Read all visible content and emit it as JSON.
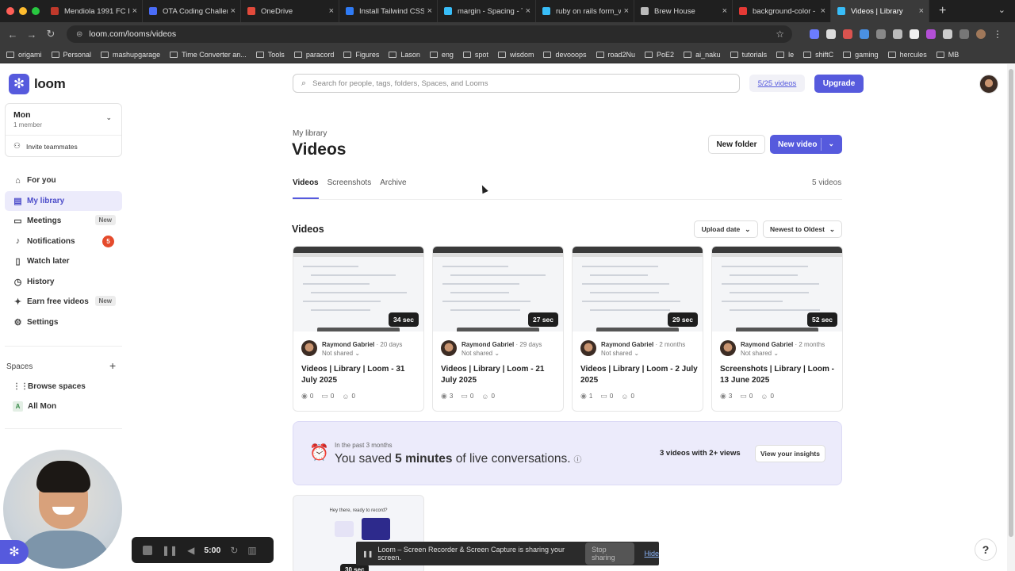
{
  "browser": {
    "tabs": [
      {
        "title": "Mendiola 1991 FC B",
        "color": "#c0392b"
      },
      {
        "title": "OTA Coding Challen",
        "color": "#4a6cf7"
      },
      {
        "title": "OneDrive",
        "color": "#e24a3b"
      },
      {
        "title": "Install Tailwind CSS",
        "color": "#2f7bf5"
      },
      {
        "title": "margin - Spacing - T",
        "color": "#38bdf8"
      },
      {
        "title": "ruby on rails form_w",
        "color": "#38bdf8"
      },
      {
        "title": "Brew House",
        "color": "#bbbbbb"
      },
      {
        "title": "background-color -",
        "color": "#e53935"
      },
      {
        "title": "Videos | Library",
        "color": "#38bdf8"
      }
    ],
    "url": "loom.com/looms/videos",
    "bookmarks": [
      "origami",
      "Personal",
      "mashupgarage",
      "Time Converter an...",
      "Tools",
      "paracord",
      "Figures",
      "Lason",
      "eng",
      "spot",
      "wisdom",
      "devooops",
      "road2Nu",
      "PoE2",
      "ai_naku",
      "tutorials",
      "le",
      "shiftC",
      "gaming",
      "hercules",
      "MB"
    ]
  },
  "sidebar": {
    "brand": "loom",
    "workspace": {
      "name": "Mon",
      "members": "1 member",
      "invite": "Invite teammates"
    },
    "nav": [
      {
        "label": "For you",
        "icon": "home-icon",
        "glyph": "⌂"
      },
      {
        "label": "My library",
        "icon": "library-icon",
        "glyph": "▤",
        "active": true
      },
      {
        "label": "Meetings",
        "icon": "meetings-icon",
        "glyph": "▭",
        "badge": "New"
      },
      {
        "label": "Notifications",
        "icon": "bell-icon",
        "glyph": "♪",
        "count": "5"
      },
      {
        "label": "Watch later",
        "icon": "bookmark-icon",
        "glyph": "▯"
      },
      {
        "label": "History",
        "icon": "history-icon",
        "glyph": "◷"
      },
      {
        "label": "Earn free videos",
        "icon": "gift-icon",
        "glyph": "✦",
        "badge": "New"
      },
      {
        "label": "Settings",
        "icon": "gear-icon",
        "glyph": "⚙"
      }
    ],
    "spaces_heading": "Spaces",
    "browse_spaces": "Browse spaces",
    "space_all": "All Mon",
    "space_all_initial": "A"
  },
  "recorder": {
    "timer": "5:00"
  },
  "header": {
    "search_placeholder": "Search for people, tags, folders, Spaces, and Looms",
    "video_count": "5/25 videos",
    "upgrade": "Upgrade"
  },
  "page": {
    "breadcrumb": "My library",
    "title": "Videos",
    "new_folder": "New folder",
    "new_video": "New video",
    "tabs": [
      "Videos",
      "Screenshots",
      "Archive"
    ],
    "total": "5 videos",
    "section": "Videos",
    "sort_field": "Upload date",
    "sort_order": "Newest to Oldest"
  },
  "cards": [
    {
      "duration": "34 sec",
      "author": "Raymond Gabriel",
      "when": "· 20 days",
      "shared": "Not shared ⌄",
      "title": "Videos | Library | Loom - 31 July 2025",
      "views": "0",
      "comments": "0",
      "reactions": "0"
    },
    {
      "duration": "27 sec",
      "author": "Raymond Gabriel",
      "when": "· 29 days",
      "shared": "Not shared ⌄",
      "title": "Videos | Library | Loom - 21 July 2025",
      "views": "3",
      "comments": "0",
      "reactions": "0"
    },
    {
      "duration": "29 sec",
      "author": "Raymond Gabriel",
      "when": "· 2 months",
      "shared": "Not shared ⌄",
      "title": "Videos | Library | Loom - 2 July 2025",
      "views": "1",
      "comments": "0",
      "reactions": "0"
    },
    {
      "duration": "52 sec",
      "author": "Raymond Gabriel",
      "when": "· 2 months",
      "shared": "Not shared ⌄",
      "title": "Screenshots | Library | Loom - 13 June 2025",
      "views": "3",
      "comments": "0",
      "reactions": "0"
    }
  ],
  "insights": {
    "period": "In the past 3 months",
    "saved_prefix": "You saved ",
    "saved_value": "5 minutes",
    "saved_suffix": " of live conversations.",
    "stat": "3 videos with 2+ views",
    "button": "View your insights"
  },
  "card5": {
    "thumb_text": "Hey there, ready to record?",
    "duration": "30 sec"
  },
  "share_bar": {
    "message": "Loom – Screen Recorder & Screen Capture is sharing your screen.",
    "stop": "Stop sharing",
    "hide": "Hide"
  },
  "help": "?",
  "colors": {
    "accent": "#565ADD",
    "accent_soft": "#ecebfb",
    "badge_red": "#e54b2c"
  }
}
